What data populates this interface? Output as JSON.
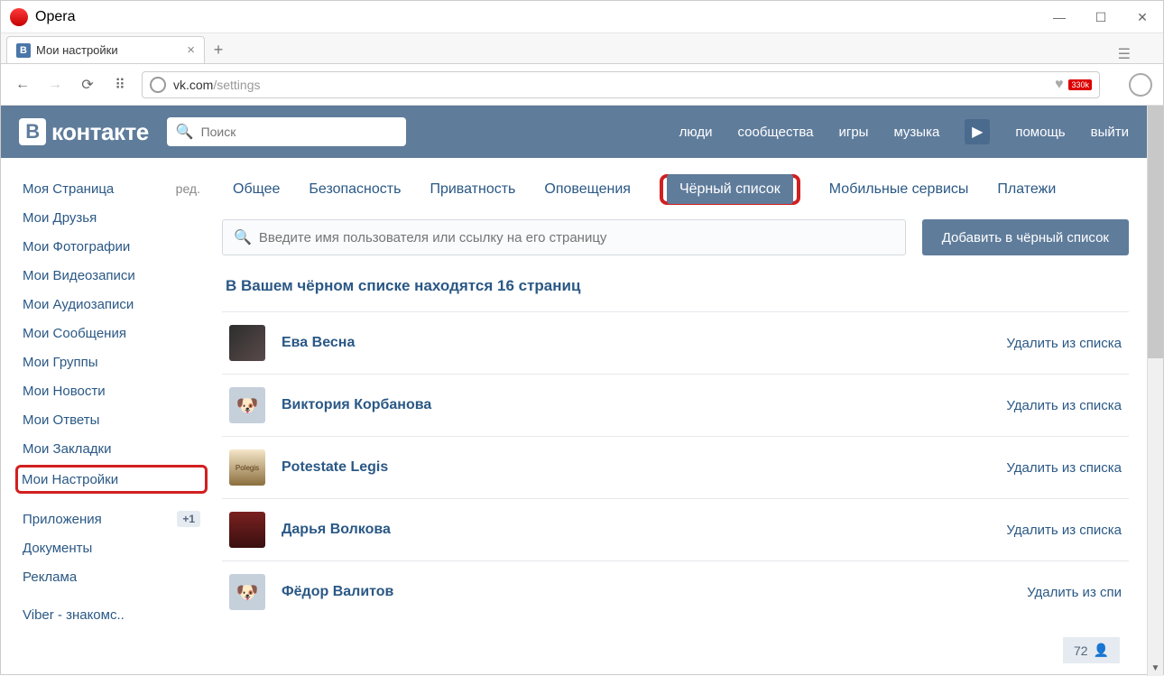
{
  "window": {
    "title": "Opera"
  },
  "window_controls": {
    "min": "—",
    "max": "☐",
    "close": "✕"
  },
  "tab": {
    "favicon": "В",
    "title": "Мои настройки",
    "close": "×"
  },
  "newtab": "+",
  "toolbar": {
    "back": "←",
    "fwd": "→",
    "reload": "⟳",
    "grid": "⠿"
  },
  "url": {
    "host": "vk.com",
    "path": "/settings"
  },
  "ext_badge": "330k",
  "heart": "♥",
  "vk": {
    "logo_b": "В",
    "logo_text": "контакте",
    "search_placeholder": "Поиск",
    "nav": {
      "people": "люди",
      "groups": "сообщества",
      "games": "игры",
      "music": "музыка",
      "play": "▶",
      "help": "помощь",
      "logout": "выйти"
    }
  },
  "sidebar": {
    "items": [
      {
        "label": "Моя Страница",
        "edit": "ред."
      },
      {
        "label": "Мои Друзья"
      },
      {
        "label": "Мои Фотографии"
      },
      {
        "label": "Мои Видеозаписи"
      },
      {
        "label": "Мои Аудиозаписи"
      },
      {
        "label": "Мои Сообщения"
      },
      {
        "label": "Мои Группы"
      },
      {
        "label": "Мои Новости"
      },
      {
        "label": "Мои Ответы"
      },
      {
        "label": "Мои Закладки"
      },
      {
        "label": "Мои Настройки",
        "highlight": true
      },
      {
        "sep": true
      },
      {
        "label": "Приложения",
        "badge": "+1"
      },
      {
        "label": "Документы"
      },
      {
        "label": "Реклама"
      },
      {
        "sep": true
      },
      {
        "label": "Viber - знакомс.."
      }
    ]
  },
  "settings_tabs": {
    "general": "Общее",
    "security": "Безопасность",
    "privacy": "Приватность",
    "notif": "Оповещения",
    "blacklist": "Чёрный список",
    "mobile": "Мобильные сервисы",
    "payments": "Платежи"
  },
  "blacklist": {
    "filter_placeholder": "Введите имя пользователя или ссылку на его страницу",
    "add_btn": "Добавить в чёрный список",
    "title": "В Вашем чёрном списке находятся 16 страниц",
    "remove": "Удалить из списка",
    "remove_trunc": "Удалить из спи",
    "items": [
      {
        "name": "Ева Весна",
        "av": "av1"
      },
      {
        "name": "Виктория Корбанова",
        "av": ""
      },
      {
        "name": "Potestate Legis",
        "av": "av3",
        "text": "Polegis"
      },
      {
        "name": "Дарья Волкова",
        "av": "av4"
      },
      {
        "name": "Фёдор Валитов",
        "av": ""
      }
    ]
  },
  "notif": {
    "count": "72"
  }
}
